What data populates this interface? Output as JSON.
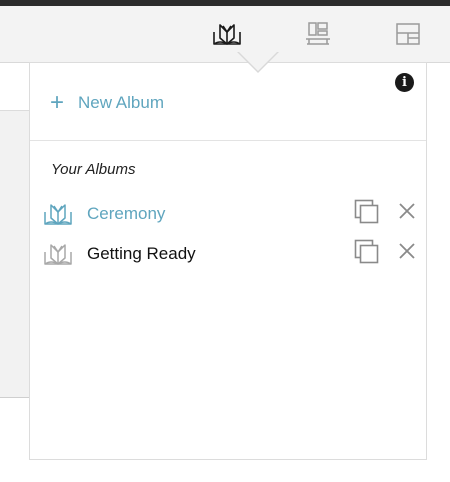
{
  "toolbar": {
    "tools": [
      {
        "icon": "album-book-icon",
        "active": true
      },
      {
        "icon": "spread-layout-icon",
        "active": false
      },
      {
        "icon": "page-layout-icon",
        "active": false
      }
    ]
  },
  "popover": {
    "info_label": "i",
    "new_album": {
      "icon": "plus-icon",
      "label": "New Album"
    },
    "section_title": "Your Albums",
    "albums": [
      {
        "name": "Ceremony",
        "active": true,
        "icon": "album-book-icon"
      },
      {
        "name": "Getting Ready",
        "active": false,
        "icon": "album-book-icon"
      }
    ]
  },
  "colors": {
    "accent": "#5fa5be",
    "icon_gray": "#8a8a8a",
    "text": "#111111"
  }
}
